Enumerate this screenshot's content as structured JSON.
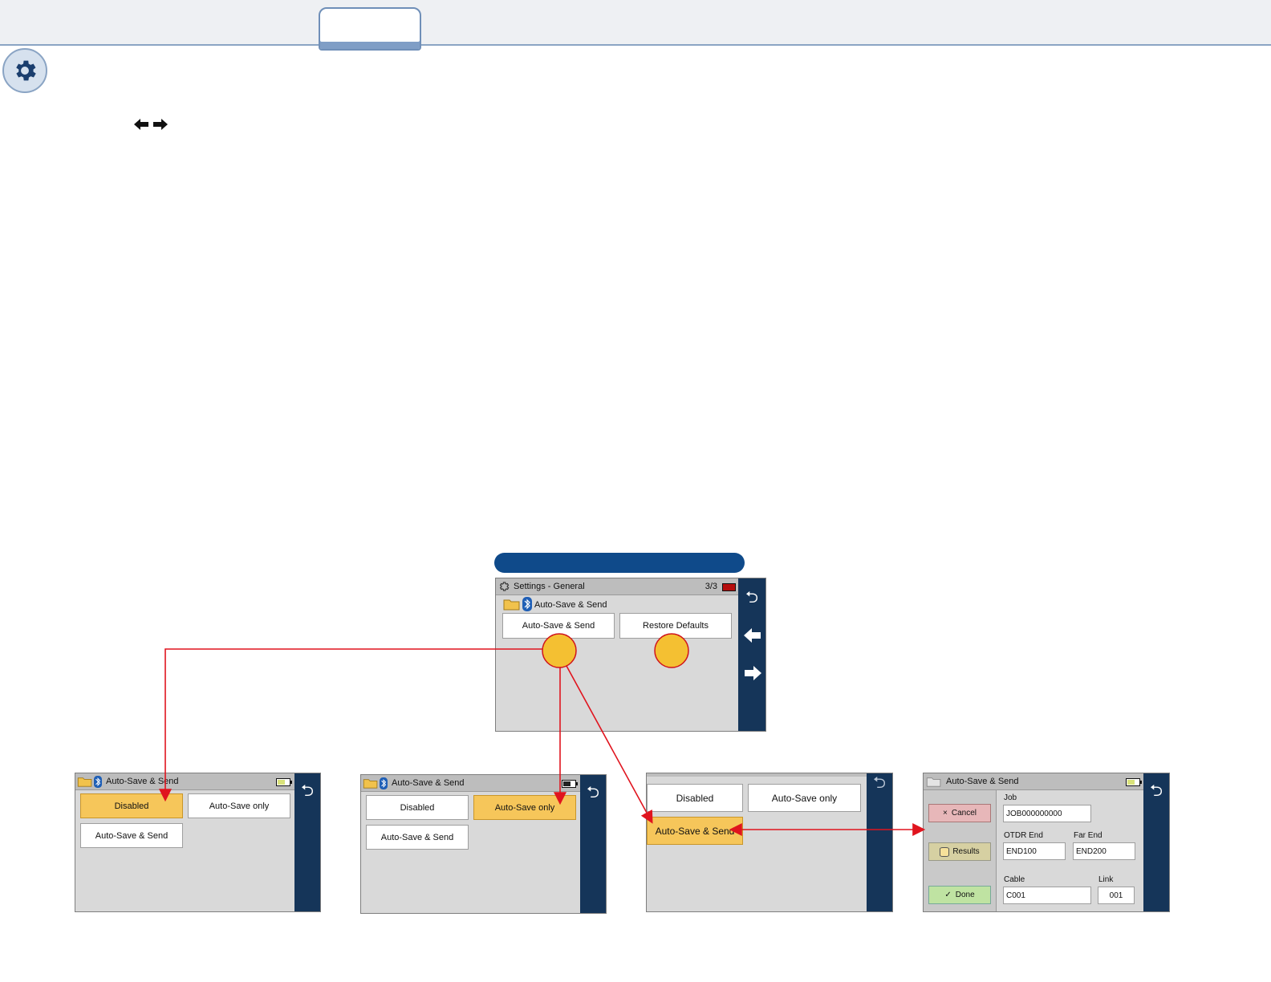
{
  "colors": {
    "selected": "#f6c65a",
    "side_panel": "#153559",
    "callout": "#f4c032",
    "connector": "#e0141e",
    "pill": "#0f4a8a"
  },
  "main_screen": {
    "title": "Settings - General",
    "page": "3/3",
    "section": "Auto-Save & Send",
    "btn_autosave_send": "Auto-Save & Send",
    "btn_restore": "Restore Defaults",
    "side_icons": [
      "back-icon",
      "arrow-left-icon",
      "arrow-right-icon"
    ]
  },
  "screen_a": {
    "title": "Auto-Save & Send",
    "btn_disabled": "Disabled",
    "btn_autosave_only": "Auto-Save only",
    "btn_autosave_send": "Auto-Save & Send",
    "selected": "Disabled"
  },
  "screen_b": {
    "title": "Auto-Save & Send",
    "btn_disabled": "Disabled",
    "btn_autosave_only": "Auto-Save only",
    "btn_autosave_send": "Auto-Save & Send",
    "selected": "Auto-Save only"
  },
  "screen_c": {
    "btn_disabled": "Disabled",
    "btn_autosave_only": "Auto-Save only",
    "btn_autosave_send": "Auto-Save & Send",
    "selected": "Auto-Save & Send"
  },
  "screen_d": {
    "title": "Auto-Save & Send",
    "btn_cancel": "Cancel",
    "btn_results": "Results",
    "btn_done": "Done",
    "job_label": "Job",
    "job_value": "JOB000000000",
    "otdr_label": "OTDR End",
    "otdr_value": "END100",
    "far_label": "Far End",
    "far_value": "END200",
    "cable_label": "Cable",
    "cable_value": "C001",
    "link_label": "Link",
    "link_value": "001"
  }
}
